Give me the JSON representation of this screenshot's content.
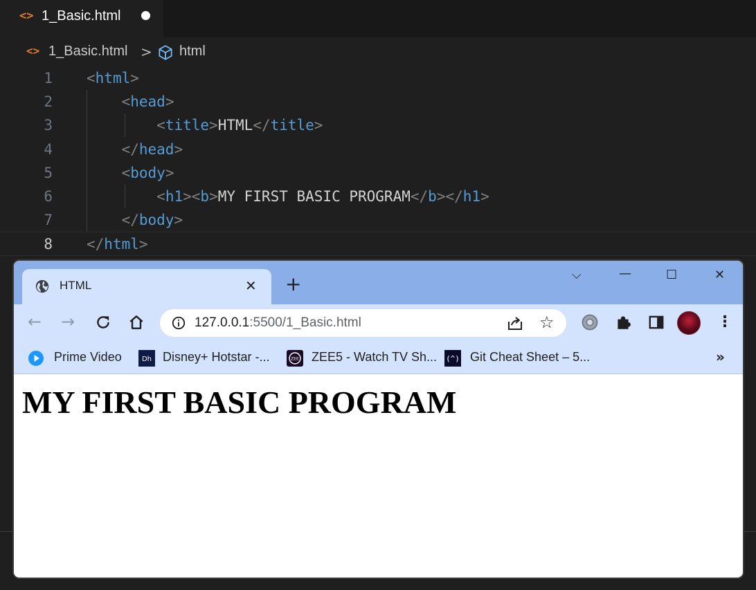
{
  "editor": {
    "tab": {
      "icon": "html-file-icon",
      "filename": "1_Basic.html",
      "dirty_indicator": "unsaved-dot"
    },
    "breadcrumb": {
      "file": "1_Basic.html",
      "separator": ">",
      "symbol": "html"
    },
    "lines": [
      {
        "number": "1",
        "tokens": [
          [
            "b",
            "<"
          ],
          [
            "t",
            "html"
          ],
          [
            "b",
            ">"
          ]
        ]
      },
      {
        "number": "2",
        "tokens": [
          [
            "s",
            "    "
          ],
          [
            "b",
            "<"
          ],
          [
            "t",
            "head"
          ],
          [
            "b",
            ">"
          ]
        ]
      },
      {
        "number": "3",
        "tokens": [
          [
            "s",
            "        "
          ],
          [
            "b",
            "<"
          ],
          [
            "t",
            "title"
          ],
          [
            "b",
            ">"
          ],
          [
            "x",
            "HTML"
          ],
          [
            "b",
            "</"
          ],
          [
            "t",
            "title"
          ],
          [
            "b",
            ">"
          ]
        ]
      },
      {
        "number": "4",
        "tokens": [
          [
            "s",
            "    "
          ],
          [
            "b",
            "</"
          ],
          [
            "t",
            "head"
          ],
          [
            "b",
            ">"
          ]
        ]
      },
      {
        "number": "5",
        "tokens": [
          [
            "s",
            "    "
          ],
          [
            "b",
            "<"
          ],
          [
            "t",
            "body"
          ],
          [
            "b",
            ">"
          ]
        ]
      },
      {
        "number": "6",
        "tokens": [
          [
            "s",
            "        "
          ],
          [
            "b",
            "<"
          ],
          [
            "t",
            "h1"
          ],
          [
            "b",
            "><"
          ],
          [
            "t",
            "b"
          ],
          [
            "b",
            ">"
          ],
          [
            "x",
            "MY FIRST BASIC PROGRAM"
          ],
          [
            "b",
            "</"
          ],
          [
            "t",
            "b"
          ],
          [
            "b",
            "></"
          ],
          [
            "t",
            "h1"
          ],
          [
            "b",
            ">"
          ]
        ]
      },
      {
        "number": "7",
        "tokens": [
          [
            "s",
            "    "
          ],
          [
            "b",
            "</"
          ],
          [
            "t",
            "body"
          ],
          [
            "b",
            ">"
          ]
        ]
      },
      {
        "number": "8",
        "tokens": [
          [
            "b",
            "</"
          ],
          [
            "t",
            "html"
          ],
          [
            "b",
            ">"
          ]
        ],
        "current": true
      }
    ]
  },
  "browser": {
    "tab": {
      "title": "HTML",
      "close": "✕"
    },
    "new_tab": "+",
    "window_controls": {
      "dropdown": "⌵",
      "minimize": "—",
      "maximize": "☐",
      "close": "✕"
    },
    "omnibox": {
      "host": "127.0.0.1",
      "path": ":5500/1_Basic.html"
    },
    "bookmarks": [
      {
        "label": "Prime Video",
        "icon": "prime-video-icon"
      },
      {
        "label": "Disney+ Hotstar -...",
        "icon": "hotstar-icon"
      },
      {
        "label": "ZEE5 - Watch TV Sh...",
        "icon": "zee5-icon"
      },
      {
        "label": "Git Cheat Sheet – 5...",
        "icon": "git-cheat-sheet-icon"
      }
    ],
    "bookmarks_overflow": "»",
    "page": {
      "heading": "MY FIRST BASIC PROGRAM"
    }
  },
  "colors": {
    "tag": "#569cd6",
    "bracket": "#808080",
    "text": "#d4d4d4",
    "accent_file_icon": "#e37933",
    "chrome_frame": "#8aafe8",
    "chrome_toolbar": "#d3e3fd"
  }
}
